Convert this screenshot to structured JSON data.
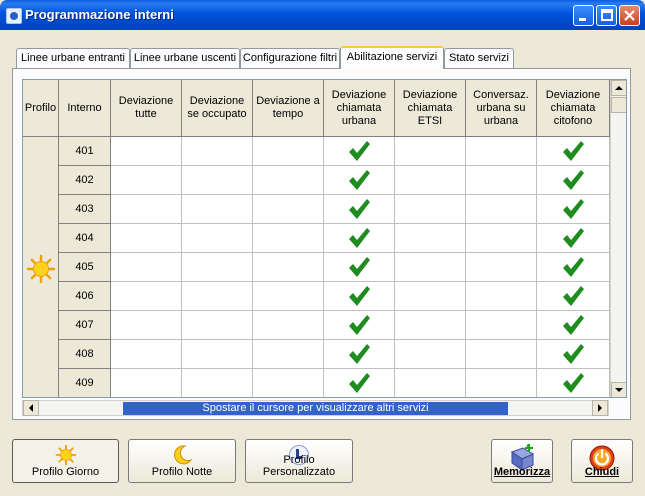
{
  "window": {
    "title": "Programmazione interni"
  },
  "tabs": [
    {
      "label": "Linee urbane entranti"
    },
    {
      "label": "Linee urbane uscenti"
    },
    {
      "label": "Configurazione filtri"
    },
    {
      "label": "Abilitazione servizi",
      "active": true
    },
    {
      "label": "Stato servizi"
    }
  ],
  "grid": {
    "columns": [
      "Profilo",
      "Interno",
      "Deviazione tutte",
      "Deviazione se occupato",
      "Deviazione a tempo",
      "Deviazione chiamata urbana",
      "Deviazione chiamata ETSI",
      "Conversaz. urbana su urbana",
      "Deviazione chiamata citofono"
    ],
    "rows": [
      {
        "interno": "401",
        "checks": [
          false,
          false,
          false,
          true,
          false,
          false,
          true
        ]
      },
      {
        "interno": "402",
        "checks": [
          false,
          false,
          false,
          true,
          false,
          false,
          true
        ]
      },
      {
        "interno": "403",
        "checks": [
          false,
          false,
          false,
          true,
          false,
          false,
          true
        ]
      },
      {
        "interno": "404",
        "checks": [
          false,
          false,
          false,
          true,
          false,
          false,
          true
        ]
      },
      {
        "interno": "405",
        "checks": [
          false,
          false,
          false,
          true,
          false,
          false,
          true
        ]
      },
      {
        "interno": "406",
        "checks": [
          false,
          false,
          false,
          true,
          false,
          false,
          true
        ]
      },
      {
        "interno": "407",
        "checks": [
          false,
          false,
          false,
          true,
          false,
          false,
          true
        ]
      },
      {
        "interno": "408",
        "checks": [
          false,
          false,
          false,
          true,
          false,
          false,
          true
        ]
      },
      {
        "interno": "409",
        "checks": [
          false,
          false,
          false,
          true,
          false,
          false,
          true
        ]
      }
    ],
    "profile_icon": "sun-icon",
    "hint": "Spostare il cursore per visualizzare altri servizi"
  },
  "buttons": {
    "profilo_giorno": "Profilo Giorno",
    "profilo_notte": "Profilo Notte",
    "profilo_personalizzato": "Profilo Personalizzato",
    "memorizza": "Memorizza",
    "chiudi": "Chiudi"
  },
  "colors": {
    "check": "#1e8c1e",
    "hint_bg": "#3264c8",
    "title_bar": "#0053dc"
  }
}
